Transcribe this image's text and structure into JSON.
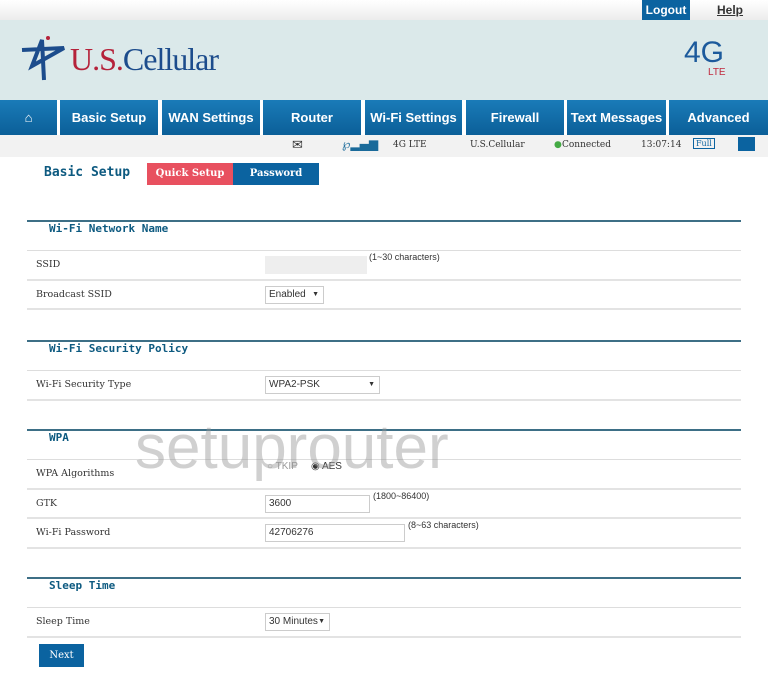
{
  "top": {
    "logout": "Logout",
    "help": "Help"
  },
  "brand": {
    "us": "U.S.",
    "cellular": "Cellular",
    "lte_big": "4G",
    "lte_small": "LTE"
  },
  "nav": [
    "Basic Setup",
    "WAN Settings",
    "Router",
    "Wi-Fi Settings",
    "Firewall",
    "Text Messages",
    "Advanced"
  ],
  "status": {
    "network": "4G LTE",
    "carrier": "U.S.Cellular",
    "connection": "Connected",
    "time": "13:07:14",
    "battery": "Full"
  },
  "page": {
    "title": "Basic Setup",
    "tabs": [
      "Quick Setup",
      "Password"
    ]
  },
  "sections": {
    "name": {
      "title": "Wi-Fi Network Name",
      "ssid_label": "SSID",
      "ssid_hint": "(1~30 characters)",
      "broadcast_label": "Broadcast SSID",
      "broadcast_value": "Enabled"
    },
    "security": {
      "title": "Wi-Fi Security Policy",
      "type_label": "Wi-Fi Security Type",
      "type_value": "WPA2-PSK"
    },
    "wpa": {
      "title": "WPA",
      "alg_label": "WPA Algorithms",
      "opt_tkip": "TKIP",
      "opt_aes": "AES",
      "selected": "AES",
      "gtk_label": "GTK",
      "gtk_value": "3600",
      "gtk_hint": "(1800~86400)",
      "pw_label": "Wi-Fi Password",
      "pw_value": "42706276",
      "pw_hint": "(8~63 characters)"
    },
    "sleep": {
      "title": "Sleep Time",
      "label": "Sleep Time",
      "value": "30 Minutes"
    }
  },
  "next": "Next",
  "watermark": "setuprouter",
  "colors": {
    "primary": "#0b63a0",
    "accent": "#e8505f",
    "header_bg": "#dbe9ea"
  }
}
